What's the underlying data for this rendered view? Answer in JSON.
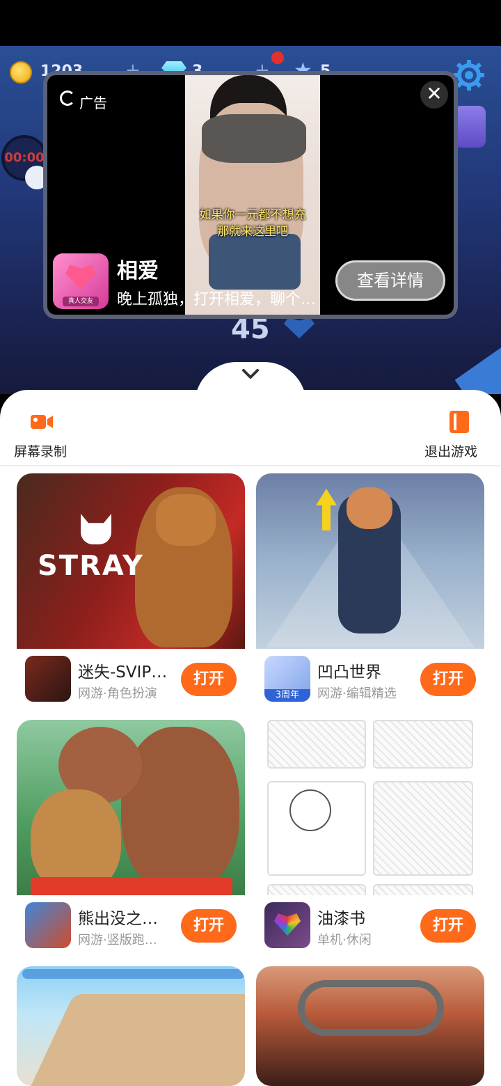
{
  "game": {
    "coins": "1203",
    "gems": "3",
    "stars": "5",
    "timer": "00:00",
    "score": "45"
  },
  "ad": {
    "label": "广告",
    "video_caption_line1": "如果你一元都不想充",
    "video_caption_line2": "那就来这里吧",
    "app_badge": "真人交友",
    "app_name": "相爱",
    "app_desc": "晚上孤独，打开相爱，聊个…",
    "cta": "查看详情",
    "close_glyph": "✕"
  },
  "sheet": {
    "record_label": "屏幕录制",
    "exit_label": "退出游戏",
    "accent_color": "#ff6a1a"
  },
  "games": [
    {
      "title": "迷失-SVIP…",
      "subtitle": "网游·角色扮演",
      "button": "打开",
      "banner_text": "STRAY"
    },
    {
      "title": "凹凸世界",
      "subtitle": "网游·编辑精选",
      "button": "打开",
      "icon_badge": "3周年"
    },
    {
      "title": "熊出没之…",
      "subtitle": "网游·竖版跑…",
      "button": "打开"
    },
    {
      "title": "油漆书",
      "subtitle": "单机·休闲",
      "button": "打开"
    }
  ]
}
